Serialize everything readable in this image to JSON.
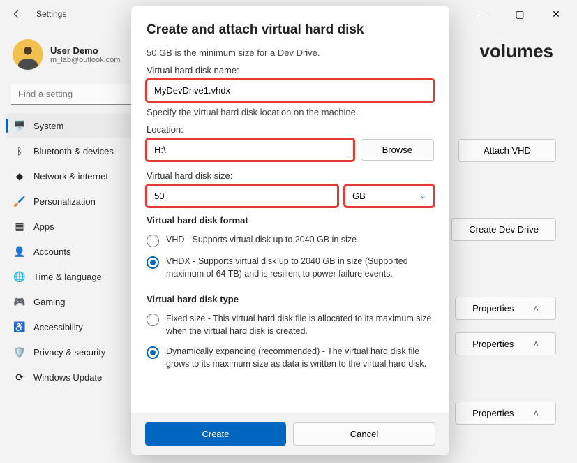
{
  "window": {
    "title": "Settings",
    "controls": {
      "min": "—",
      "max": "▢",
      "close": "✕"
    }
  },
  "profile": {
    "name": "User Demo",
    "email": "m_lab@outlook.com"
  },
  "search": {
    "placeholder": "Find a setting"
  },
  "sidebar": {
    "items": [
      {
        "icon": "🖥️",
        "label": "System",
        "active": true
      },
      {
        "icon": "ᛒ",
        "label": "Bluetooth & devices"
      },
      {
        "icon": "◆",
        "label": "Network & internet"
      },
      {
        "icon": "🖌️",
        "label": "Personalization"
      },
      {
        "icon": "▦",
        "label": "Apps"
      },
      {
        "icon": "👤",
        "label": "Accounts"
      },
      {
        "icon": "🌐",
        "label": "Time & language"
      },
      {
        "icon": "🎮",
        "label": "Gaming"
      },
      {
        "icon": "♿",
        "label": "Accessibility"
      },
      {
        "icon": "🛡️",
        "label": "Privacy & security"
      },
      {
        "icon": "⟳",
        "label": "Windows Update"
      }
    ]
  },
  "main": {
    "title_fragment": "volumes",
    "attach_btn": "Attach VHD",
    "create_dev_btn": "Create Dev Drive",
    "properties_btn": "Properties",
    "chev_up": "˄"
  },
  "modal": {
    "title": "Create and attach virtual hard disk",
    "hint": "50 GB is the minimum size for a Dev Drive.",
    "name_label": "Virtual hard disk name:",
    "name_value": "MyDevDrive1.vhdx",
    "location_hint": "Specify the virtual hard disk location on the machine.",
    "location_label": "Location:",
    "location_value": "H:\\",
    "browse": "Browse",
    "size_label": "Virtual hard disk size:",
    "size_value": "50",
    "size_unit": "GB",
    "format_label": "Virtual hard disk format",
    "format_options": [
      {
        "text": "VHD - Supports virtual disk up to 2040 GB in size",
        "checked": false
      },
      {
        "text": "VHDX - Supports virtual disk up to 2040 GB in size (Supported maximum of 64 TB) and is resilient to power failure events.",
        "checked": true
      }
    ],
    "type_label": "Virtual hard disk type",
    "type_options": [
      {
        "text": "Fixed size - This virtual hard disk file is allocated to its maximum size when the virtual hard disk is created.",
        "checked": false
      },
      {
        "text": "Dynamically expanding (recommended) - The virtual hard disk file grows to its maximum size as data is written to the virtual hard disk.",
        "checked": true
      }
    ],
    "create": "Create",
    "cancel": "Cancel"
  }
}
